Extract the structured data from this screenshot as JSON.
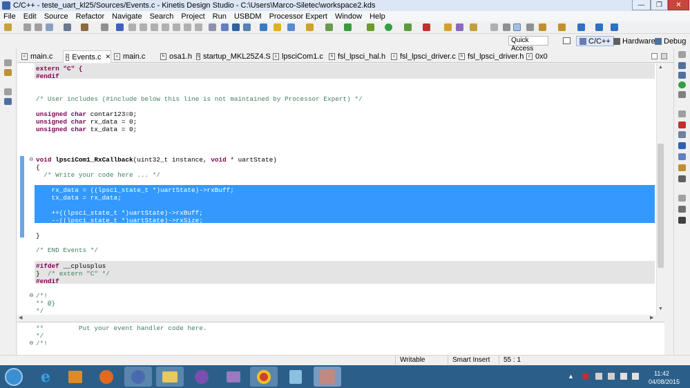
{
  "window": {
    "title": "C/C++ - teste_uart_kl25/Sources/Events.c - Kinetis Design Studio - C:\\Users\\Marco-Siletec\\workspace2.kds",
    "minimize_glyph": "—",
    "restore_glyph": "❐",
    "close_glyph": "✕"
  },
  "menubar": [
    "File",
    "Edit",
    "Source",
    "Refactor",
    "Navigate",
    "Search",
    "Project",
    "Run",
    "USBDM",
    "Processor Expert",
    "Window",
    "Help"
  ],
  "perspective": {
    "quick_access_placeholder": "Quick Access",
    "cpp_label": "C/C++",
    "hardware_label": "Hardware",
    "debug_label": "Debug"
  },
  "tabs": [
    {
      "label": "main.c",
      "icon": "c-file-icon"
    },
    {
      "label": "Events.c",
      "icon": "c-file-icon",
      "active": true,
      "close": "✕"
    },
    {
      "label": "main.c",
      "icon": "c-file-icon"
    },
    {
      "label": "osa1.h",
      "icon": "h-file-icon"
    },
    {
      "label": "startup_MKL25Z4.S",
      "icon": "s-file-icon"
    },
    {
      "label": "lpsciCom1.c",
      "icon": "c-file-icon"
    },
    {
      "label": "fsl_lpsci_hal.h",
      "icon": "h-file-icon"
    },
    {
      "label": "fsl_lpsci_driver.c",
      "icon": "c-file-icon"
    },
    {
      "label": "fsl_lpsci_driver.h",
      "icon": "h-file-icon"
    },
    {
      "label": "0x0",
      "icon": "c-file-icon"
    }
  ],
  "code": {
    "l01": "extern \"C\" {",
    "l02": "#endif",
    "l03": "/* User includes (#include below this line is not maintained by Processor Expert) */",
    "l04a": "unsigned char",
    "l04b": " contar123=0;",
    "l05a": "unsigned char",
    "l05b": " rx_data = 0;",
    "l06a": "unsigned char",
    "l06b": " tx_data = 0;",
    "l07a": "void",
    "l07b": " lpsciCom1_RxCallback",
    "l07c": "(uint32_t instance, ",
    "l07d": "void",
    "l07e": " * uartState)",
    "l08": "{",
    "l09": "  /* Write your code here ... */",
    "l10": "    rx_data = ((lpsci_state_t *)uartState)->rxBuff;",
    "l11": "    tx_data = rx_data;",
    "l12": "    ++((lpsci_state_t *)uartState)->rxBuff;",
    "l13": "    --((lpsci_state_t *)uartState)->rxSize;",
    "l14": "}",
    "l15": "/* END Events */",
    "l16a": "#ifdef",
    "l16b": " __cplusplus",
    "l17a": "}  ",
    "l17b": "/* extern \"C\" */",
    "l18": "#endif",
    "l19": "/*!",
    "l20": "** @}",
    "l21": "*/"
  },
  "bottom_code": {
    "b1": "**         Put your event handler code here.",
    "b2": "*/",
    "b3": "/*!"
  },
  "status": {
    "writable": "Writable",
    "insert_mode": "Smart Insert",
    "position": "55 : 1"
  },
  "tray": {
    "time": "11:42",
    "date": "04/08/2015"
  },
  "colors": {
    "selection": "#3399ff",
    "keyword": "#7f0055",
    "comment": "#3f7f5f",
    "taskbar": "#2b5f8a"
  }
}
